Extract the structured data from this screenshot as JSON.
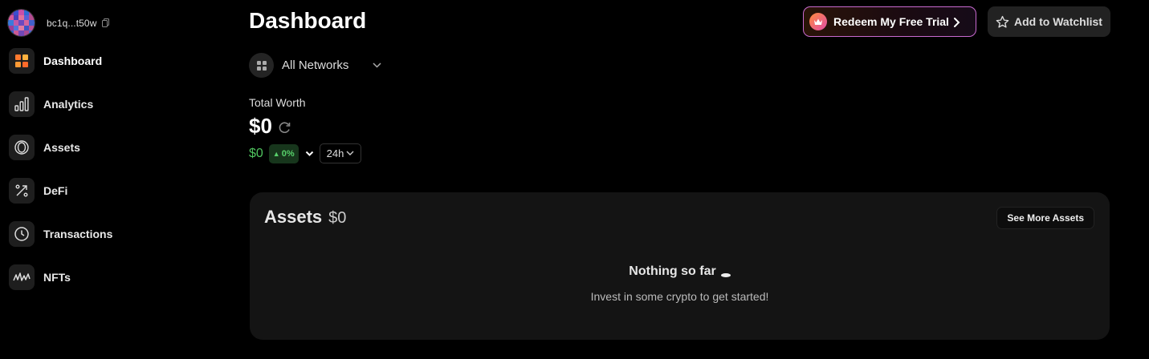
{
  "wallet": {
    "address": "bc1q...t50w",
    "avatar_colors": [
      "#8b3a8f",
      "#3b4fd0",
      "#c94fa8",
      "#2d6bd4",
      "#a64ca0",
      "#d65a9b",
      "#4a3fb8",
      "#e2709a",
      "#5a5fd6",
      "#b34c8f",
      "#3a7bdc",
      "#c05aa8",
      "#6b4ac0",
      "#d4649e",
      "#4260cc",
      "#9c3e9a",
      "#5474dc",
      "#e07aa4",
      "#3e55c6",
      "#b65098",
      "#2f5ec8",
      "#c85a96",
      "#7048b8",
      "#a84a94",
      "#4a6ad2"
    ]
  },
  "sidebar": {
    "items": [
      {
        "label": "Dashboard",
        "icon": "dashboard-icon",
        "active": true
      },
      {
        "label": "Analytics",
        "icon": "analytics-icon",
        "active": false
      },
      {
        "label": "Assets",
        "icon": "assets-icon",
        "active": false
      },
      {
        "label": "DeFi",
        "icon": "defi-icon",
        "active": false
      },
      {
        "label": "Transactions",
        "icon": "transactions-icon",
        "active": false
      },
      {
        "label": "NFTs",
        "icon": "nfts-icon",
        "active": false
      }
    ]
  },
  "header": {
    "title": "Dashboard",
    "redeem_label": "Redeem My Free Trial",
    "watchlist_label": "Add to Watchlist"
  },
  "network": {
    "selected": "All Networks"
  },
  "worth": {
    "label": "Total Worth",
    "value": "$0",
    "change_value": "$0",
    "change_pct": "0%",
    "period": "24h"
  },
  "assets": {
    "title": "Assets",
    "total": "$0",
    "see_more_label": "See More Assets",
    "empty_title": "Nothing so far",
    "empty_sub": "Invest in some crypto to get started!"
  },
  "colors": {
    "accent_orange": "#ff8a3c",
    "accent_pink": "#e24ca8",
    "positive_green": "#4fc35e"
  }
}
